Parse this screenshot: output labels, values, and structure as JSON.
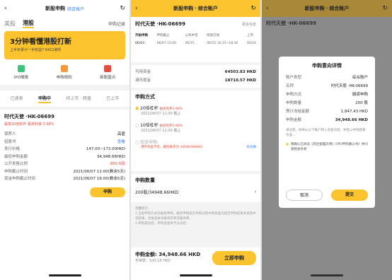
{
  "p1": {
    "title": "新股申购",
    "account": "综合账户",
    "tab_us": "美股",
    "tab_hk": "港股",
    "record": "申购记录",
    "banner_big": "3分钟看懂港股打新",
    "banner_sub": "上半年累计一手收益7 6422港币",
    "icons": [
      "IPO情报",
      "申购规则",
      "新股盘点"
    ],
    "subtabs": [
      "已递表",
      "申购中",
      "待上市 · 暗盘",
      "已上市"
    ],
    "stock": "时代天使 ·HK-06699",
    "tag1": "最高20倍杠杆",
    "tag2": "融资利率 3.98%",
    "rows": [
      [
        "保荐人",
        "高盛"
      ],
      [
        "招股书",
        "查看"
      ],
      [
        "发行价格",
        "147.00~173.00HKD"
      ],
      [
        "最低申购金额",
        "34,948.66HKD"
      ],
      [
        "公开发售比例",
        "850.6倍"
      ],
      [
        "申购截止时间",
        "2021/06/07 11:00(剩余5天)"
      ],
      [
        "现金申购截止时间",
        "2021/06/07 16:00(剩余5天)"
      ]
    ],
    "buy": "申购"
  },
  "p2": {
    "title": "新股申购",
    "account": "综合账户",
    "stock": "时代天使 ·HK-06699",
    "more": "更多信息",
    "timeline": [
      [
        "开始申购",
        "06/03"
      ],
      [
        "申购截止",
        "06/07 11:00"
      ],
      [
        "公布中签",
        "06/15"
      ],
      [
        "暗盘交易",
        "06/15 16:15~18:30"
      ],
      [
        "上市",
        "06/16"
      ]
    ],
    "avail_label": "可用资金",
    "avail_val": "64503.83 HKD",
    "hkd_label": "港币现金",
    "hkd_val": "18710.57 HKD",
    "method_title": "申购方式",
    "opt1": "20倍杠杆",
    "opt1_tag": "融资利率3.98%",
    "opt1_date": "2021/06/07 11:00 截止",
    "opt2": "10倍杠杆",
    "opt2_tag": "融资利率3.98%",
    "opt2_date": "2021/06/07 11:00 截止",
    "opt3": "现金申购",
    "opt3_warn": "港币现金不足，最低要求为 34948.66HKD",
    "opt3_link": "去兑换",
    "qty_title": "申购数量",
    "qty_val": "200股/34948.66HKD",
    "note_title": "温馨提示：",
    "note_1": "1.当前申购方式为融资申购，融资申购后在申购过程中将资金冻结至申购结束并发放中签结果，资金成本为融资利率及服务费...",
    "note_2": "2.申购成功后，申购资金将予以冻结...",
    "total_label": "申购金额:",
    "total_val": "34,948.66 HKD",
    "total_sub": "手续费：100.16 HKD",
    "submit": "立即申购"
  },
  "p3": {
    "title": "新股申购",
    "account": "综合账户",
    "stock": "时代天使 ·HK-06699",
    "modal_title": "申购意向详情",
    "rows": [
      [
        "账户类型",
        "综合账户"
      ],
      [
        "名称",
        "时代天使 ·HK-06699"
      ],
      [
        "申购方式",
        "融资申购"
      ],
      [
        "申购数量",
        "200 股"
      ],
      [
        "预计冻结金额",
        "1,847.43 HKD"
      ],
      [
        "申购金额",
        "34,948.66 HKD"
      ]
    ],
    "notice": "请注意，你将从以下账户转入资金冻结，并且以中签结果为准...",
    "agree": "我确认已阅读《风险披露声明》《IPO申购确认书》并同意相关条款",
    "cancel": "取消",
    "confirm": "提交"
  },
  "colors": {
    "accent": "#fbc32e",
    "red": "#e64b3b",
    "blue": "#2b7df0"
  }
}
